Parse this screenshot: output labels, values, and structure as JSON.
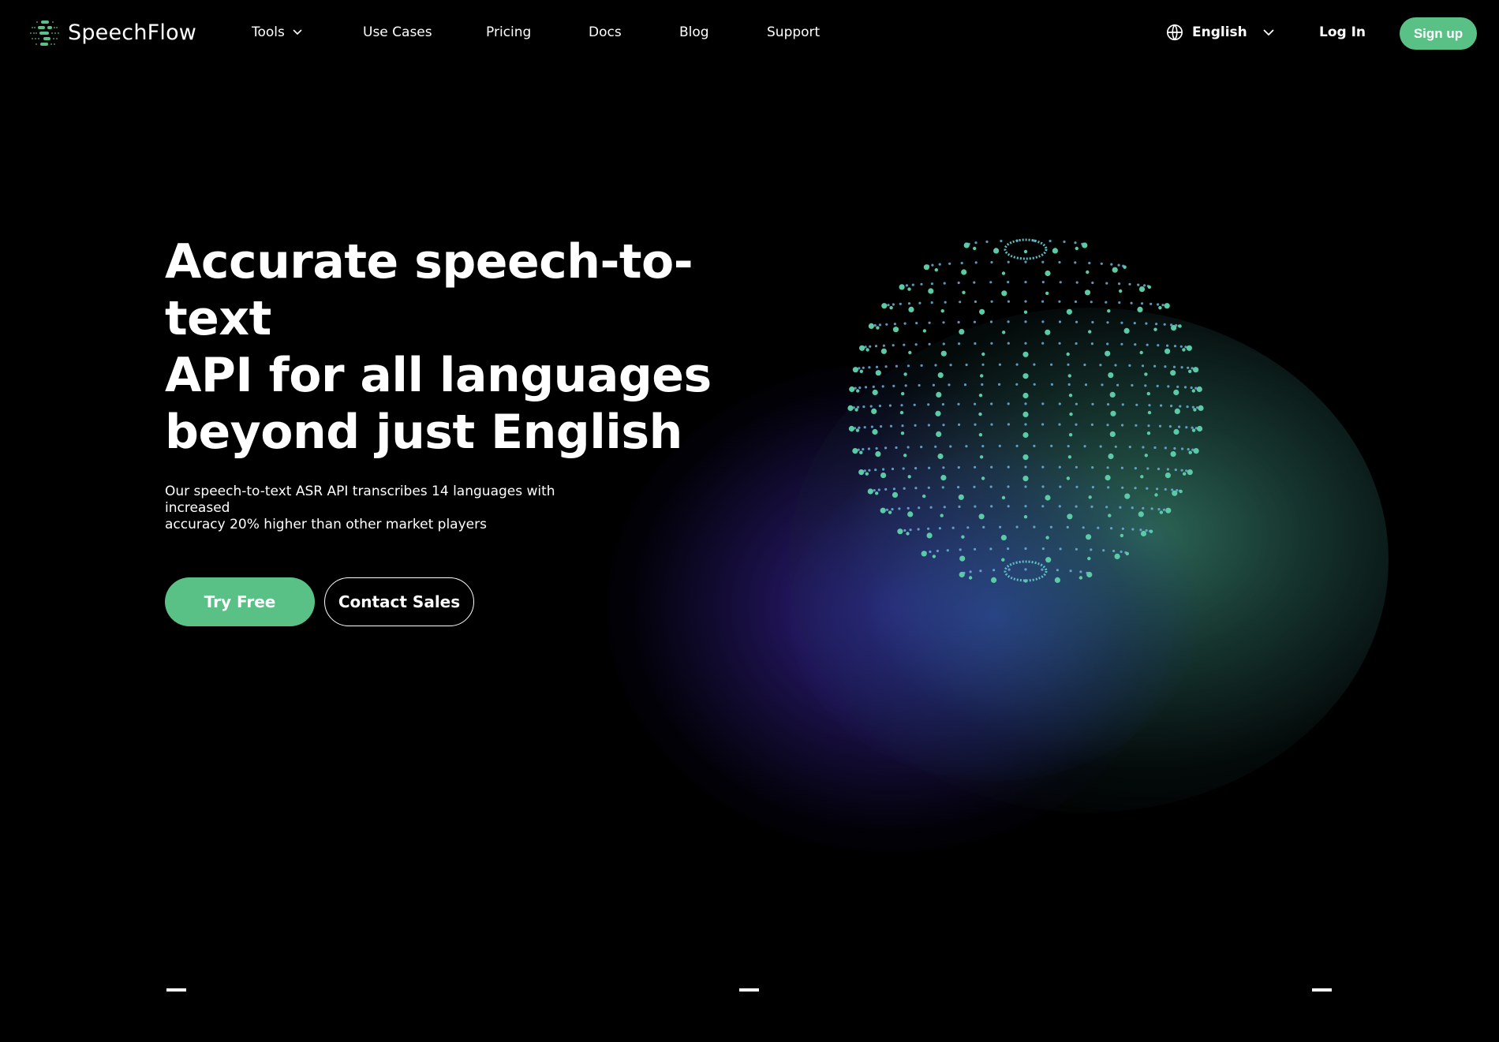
{
  "brand": {
    "name": "SpeechFlow",
    "accent": "#5ac186",
    "background": "#000000"
  },
  "nav": {
    "items": [
      {
        "label": "Tools",
        "has_dropdown": true
      },
      {
        "label": "Use Cases"
      },
      {
        "label": "Pricing"
      },
      {
        "label": "Docs"
      },
      {
        "label": "Blog"
      },
      {
        "label": "Support"
      }
    ],
    "language": {
      "icon": "globe-icon",
      "selected": "English"
    },
    "login_label": "Log In",
    "signup_label": "Sign up"
  },
  "hero": {
    "title_lines": [
      "Accurate speech-to-text",
      "API for all languages",
      "beyond just English"
    ],
    "subtitle_lines": [
      "Our speech-to-text ASR API transcribes 14 languages with increased",
      "accuracy 20% higher than other market players"
    ],
    "primary_cta": "Try Free",
    "secondary_cta": "Contact Sales"
  },
  "illustration": {
    "name": "dotted-globe-illustration",
    "dot_color": "#5cc9a7",
    "glow_colors": [
      "#3a2a9a",
      "#2f5fa6",
      "#3a8a6a"
    ]
  },
  "slider_indicators": {
    "count": 3
  }
}
